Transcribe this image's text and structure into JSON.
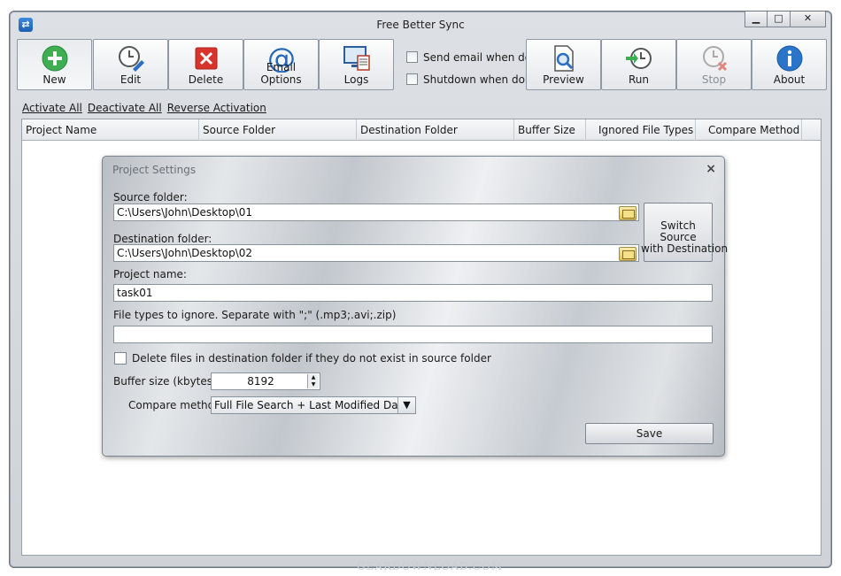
{
  "window": {
    "title": "Free Better Sync",
    "min": "▁",
    "max": "□",
    "close": "✕"
  },
  "toolbar": {
    "new": "New",
    "edit": "Edit",
    "delete": "Delete",
    "email_options": "Email Options",
    "logs": "Logs",
    "preview": "Preview",
    "run": "Run",
    "stop": "Stop",
    "about": "About",
    "send_email": "Send email when done",
    "shutdown": "Shutdown when done"
  },
  "links": {
    "activate_all": "Activate All",
    "deactivate_all": "Deactivate All",
    "reverse_activation": "Reverse Activation"
  },
  "grid": {
    "columns": [
      "Project Name",
      "Source Folder",
      "Destination Folder",
      "Buffer Size",
      "Ignored File Types",
      "Compare Method"
    ]
  },
  "dialog": {
    "title": "Project Settings",
    "close": "×",
    "source_label": "Source folder:",
    "source_value": "C:\\Users\\John\\Desktop\\01",
    "dest_label": "Destination folder:",
    "dest_value": "C:\\Users\\John\\Desktop\\02",
    "switch_line1": "Switch Source",
    "switch_line2": "with Destination",
    "project_label": "Project name:",
    "project_value": "task01",
    "ignore_label": "File types to ignore. Separate with \";\" (.mp3;.avi;.zip)",
    "ignore_value": "",
    "delete_label": "Delete files in destination folder if they do not exist in source folder",
    "buffer_label": "Buffer size (kbytes):",
    "buffer_value": "8192",
    "compare_label": "Compare method:",
    "compare_value": "Full File Search + Last Modified Date",
    "save": "Save"
  },
  "watermark": "GEARDOWNLOAD.COM",
  "colors": {
    "new_green": "#3fae52",
    "delete_red": "#d9342b",
    "email_blue": "#2468b8",
    "about_blue": "#2a74c9"
  }
}
